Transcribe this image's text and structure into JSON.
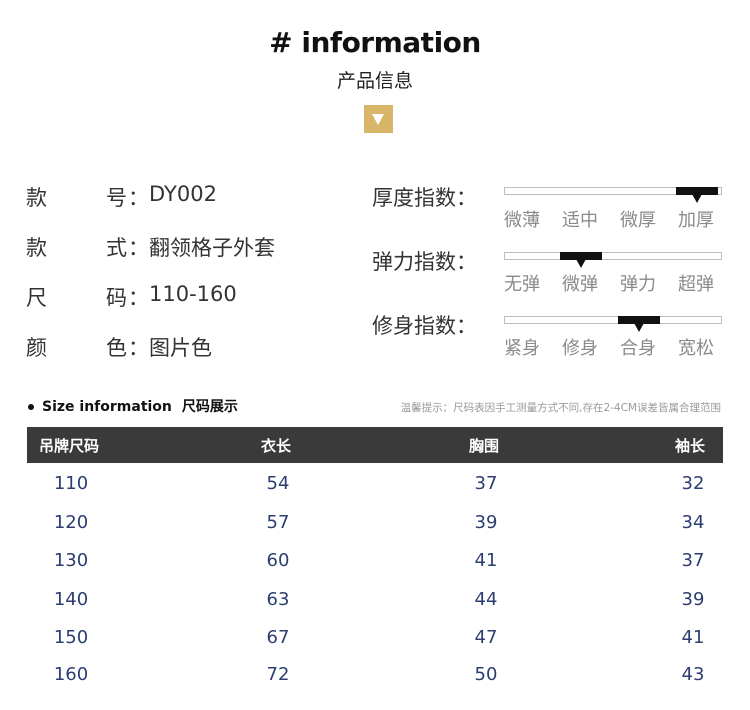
{
  "header": {
    "title": "# information",
    "subtitle": "产品信息"
  },
  "specs": [
    {
      "k1": "款",
      "k2": "号",
      "value": "DY002"
    },
    {
      "k1": "款",
      "k2": "式",
      "value": "翻领格子外套"
    },
    {
      "k1": "尺",
      "k2": "码",
      "value": "110-160"
    },
    {
      "k1": "颜",
      "k2": "色",
      "value": "图片色"
    }
  ],
  "spec_colon": "：",
  "indexes": [
    {
      "label": "厚度指数：",
      "options": [
        "微薄",
        "适中",
        "微厚",
        "加厚"
      ],
      "selected": "加厚",
      "level": 0.89
    },
    {
      "label": "弹力指数：",
      "options": [
        "无弹",
        "微弹",
        "弹力",
        "超弹"
      ],
      "selected": "微弹",
      "level": 0.35
    },
    {
      "label": "修身指数：",
      "options": [
        "紧身",
        "修身",
        "合身",
        "宽松"
      ],
      "selected": "合身",
      "level": 0.62
    }
  ],
  "size_section": {
    "title_en": "Size information",
    "title_cn": "尺码展示",
    "tip": "温馨提示：尺码表因手工测量方式不同,存在2-4CM误差皆属合理范围"
  },
  "table": {
    "headers": [
      "吊牌尺码",
      "衣长",
      "胸围",
      "袖长"
    ],
    "rows": [
      [
        "110",
        "54",
        "37",
        "32"
      ],
      [
        "120",
        "57",
        "39",
        "34"
      ],
      [
        "130",
        "60",
        "41",
        "37"
      ],
      [
        "140",
        "63",
        "44",
        "39"
      ],
      [
        "150",
        "67",
        "47",
        "41"
      ],
      [
        "160",
        "72",
        "50",
        "43"
      ]
    ]
  },
  "colors": {
    "accent": "#d9b56a",
    "table_header_bg": "#3a3a3a",
    "table_text": "#2c3e70",
    "indicator": "#111111"
  }
}
